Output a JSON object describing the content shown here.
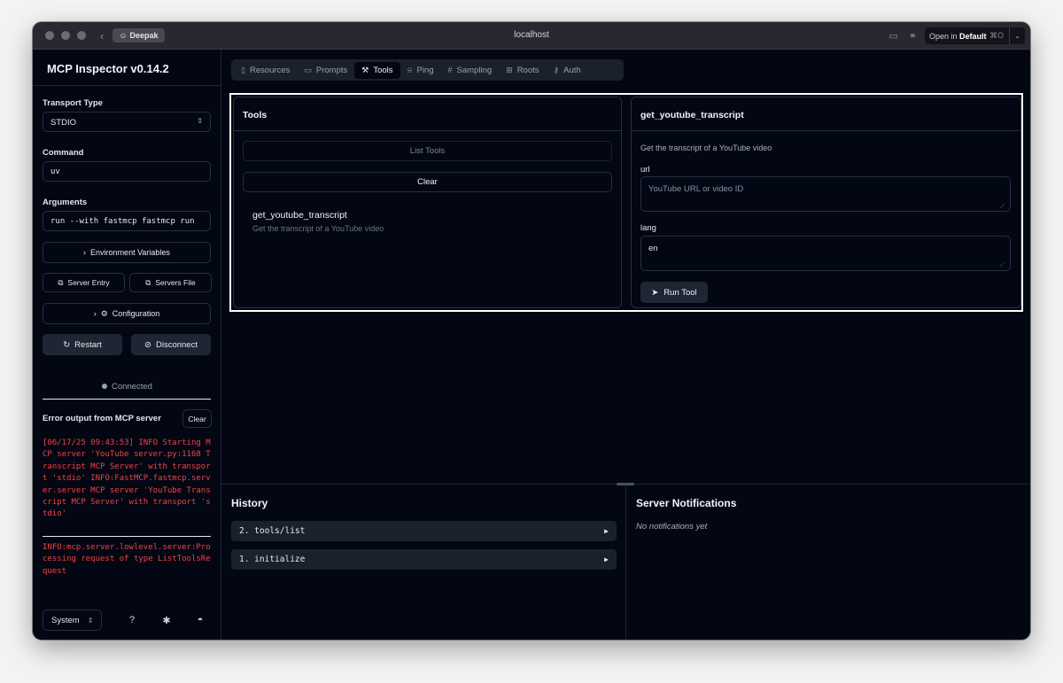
{
  "browser": {
    "profile": "Deepak",
    "url": "localhost",
    "open_in_prefix": "Open in",
    "open_in_target": "Default",
    "open_in_shortcut": "⌘O"
  },
  "sidebar": {
    "title": "MCP Inspector v0.14.2",
    "transport_label": "Transport Type",
    "transport_value": "STDIO",
    "command_label": "Command",
    "command_value": "uv",
    "arguments_label": "Arguments",
    "arguments_value": "run --with fastmcp fastmcp run",
    "env_vars_label": "Environment Variables",
    "server_entry_label": "Server Entry",
    "servers_file_label": "Servers File",
    "configuration_label": "Configuration",
    "restart_label": "Restart",
    "disconnect_label": "Disconnect",
    "status": "Connected",
    "error_title": "Error output from MCP server",
    "error_clear": "Clear",
    "logs": [
      "[06/17/25 09:43:53] INFO Starting MCP server 'YouTube server.py:1168 Transcript MCP Server' with transport 'stdio' INFO:FastMCP.fastmcp.server.server MCP server 'YouTube Transcript MCP Server' with transport 'stdio'",
      "INFO:mcp.server.lowlevel.server:Processing request of type ListToolsRequest"
    ],
    "theme": "System"
  },
  "tabs": [
    {
      "label": "Resources",
      "icon": "file-icon"
    },
    {
      "label": "Prompts",
      "icon": "message-icon"
    },
    {
      "label": "Tools",
      "icon": "hammer-icon"
    },
    {
      "label": "Ping",
      "icon": "bell-icon"
    },
    {
      "label": "Sampling",
      "icon": "hash-icon"
    },
    {
      "label": "Roots",
      "icon": "folder-tree-icon"
    },
    {
      "label": "Auth",
      "icon": "key-icon"
    }
  ],
  "active_tab": "Tools",
  "tools_panel": {
    "title": "Tools",
    "list_button": "List Tools",
    "clear_button": "Clear",
    "items": [
      {
        "name": "get_youtube_transcript",
        "description": "Get the transcript of a YouTube video"
      }
    ]
  },
  "tool_detail": {
    "title": "get_youtube_transcript",
    "description": "Get the transcript of a YouTube video",
    "params": [
      {
        "name": "url",
        "value": "",
        "placeholder": "YouTube URL or video ID"
      },
      {
        "name": "lang",
        "value": "en",
        "placeholder": ""
      }
    ],
    "run_button": "Run Tool"
  },
  "history": {
    "title": "History",
    "items": [
      "2. tools/list",
      "1. initialize"
    ]
  },
  "notifications": {
    "title": "Server Notifications",
    "empty": "No notifications yet"
  }
}
